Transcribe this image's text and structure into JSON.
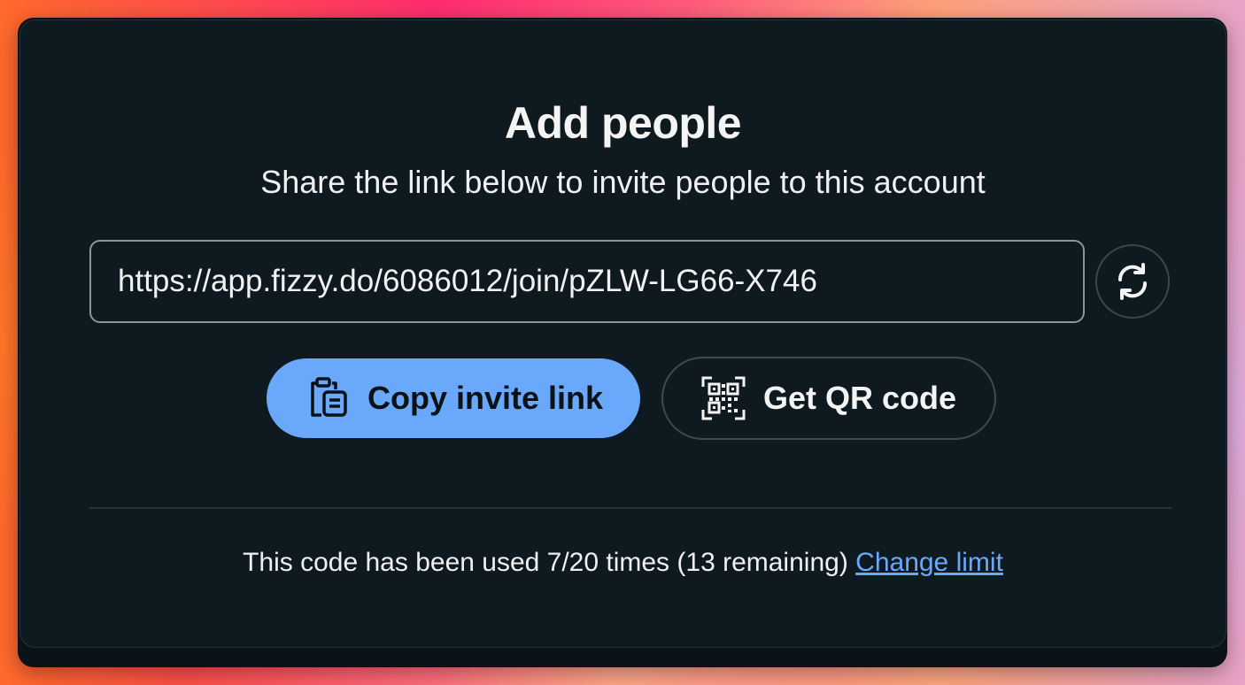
{
  "dialog": {
    "title": "Add people",
    "subtitle": "Share the link below to invite people to this account",
    "invite_link": "https://app.fizzy.do/6086012/join/pZLW-LG66-X746",
    "refresh_icon": "refresh-icon",
    "copy_button": {
      "label": "Copy invite link",
      "icon": "clipboard-icon"
    },
    "qr_button": {
      "label": "Get QR code",
      "icon": "qr-code-icon"
    },
    "usage_text": "This code has been used 7/20 times (13 remaining)",
    "change_limit_label": "Change limit"
  },
  "colors": {
    "accent": "#6aa8fb",
    "background": "#0e1a1f"
  }
}
